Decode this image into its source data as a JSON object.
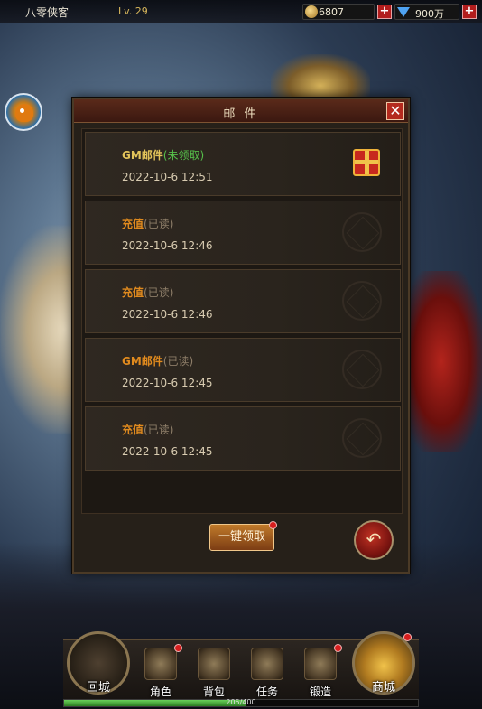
{
  "player": {
    "name": "八零侠客",
    "level": "Lv. 29"
  },
  "resources": {
    "gold": "6807",
    "diamond": "900万"
  },
  "mail": {
    "title": "邮 件",
    "close": "✕",
    "items": [
      {
        "subject": "GM邮件",
        "status": "(未领取)",
        "date": "2022-10-6 12:51",
        "read": false
      },
      {
        "subject": "充值",
        "status": "(已读)",
        "date": "2022-10-6 12:46",
        "read": true
      },
      {
        "subject": "充值",
        "status": "(已读)",
        "date": "2022-10-6 12:46",
        "read": true
      },
      {
        "subject": "GM邮件",
        "status": "(已读)",
        "date": "2022-10-6 12:45",
        "read": true
      },
      {
        "subject": "充值",
        "status": "(已读)",
        "date": "2022-10-6 12:45",
        "read": true
      }
    ],
    "claim_all": "一键领取",
    "back_icon": "back-arrow-icon"
  },
  "nav": {
    "town": "回城",
    "character": "角色",
    "bag": "背包",
    "quest": "任务",
    "forge": "锻造",
    "shop": "商城"
  },
  "exp": {
    "text": "205/400",
    "fraction": 0.5125
  },
  "colors": {
    "unread_status": "#56c04a",
    "read_subject": "#e08a1e",
    "alert_dot": "#d61e1e"
  }
}
